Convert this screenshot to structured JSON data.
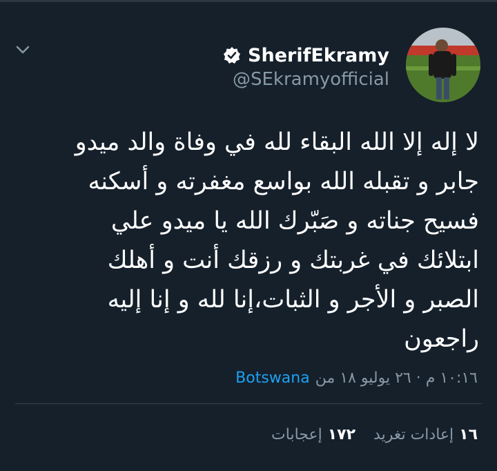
{
  "tweet": {
    "display_name": "SherifEkramy",
    "handle": "@SEkramyofficial",
    "text": "لا إله إلا الله البقاء لله في وفاة والد ميدو\nجابر و تقبله الله بواسع مغفرته و أسكنه\nفسيح جناته و صَبّرك الله يا ميدو علي\nابتلائك في غربتك و رزقك أنت و أهلك\nالصبر و الأجر و الثبات،إنا لله و إنا إليه\nراجعون",
    "timestamp": "١٠:١٦ م · ٢٦ يوليو ١٨ من",
    "source": "Botswana",
    "retweets_count": "١٦",
    "retweets_label": "إعادات تغريد",
    "likes_count": "١٧٢",
    "likes_label": "إعجابات"
  },
  "icons": {
    "chevron": "chevron-down-icon",
    "verified": "verified-badge-icon"
  },
  "colors": {
    "background": "#15202b",
    "secondary_text": "#8899a6",
    "link": "#1da1f2"
  }
}
